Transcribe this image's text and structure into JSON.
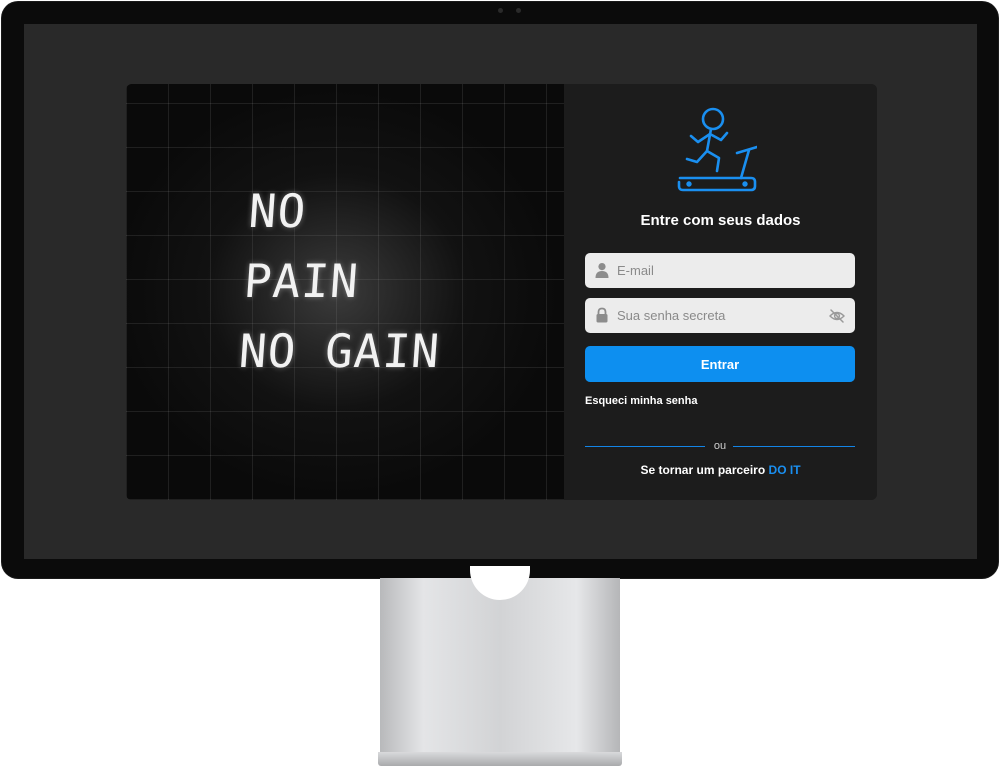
{
  "hero": {
    "lines": [
      "NO",
      "PAIN",
      "NO GAIN"
    ]
  },
  "login": {
    "title": "Entre com seus dados",
    "email_placeholder": "E-mail",
    "password_placeholder": "Sua senha secreta",
    "submit_label": "Entrar",
    "forgot_label": "Esqueci minha senha",
    "divider_label": "ou",
    "partner_text": "Se tornar um parceiro",
    "partner_link": "DO IT"
  },
  "icons": {
    "logo": "treadmill-runner-icon",
    "email": "user-icon",
    "password": "lock-icon",
    "toggle_password": "eye-slash-icon"
  },
  "colors": {
    "accent": "#0d8ff0",
    "link": "#1a8ff0",
    "panel_bg": "#1c1c1c",
    "screen_bg": "#292929",
    "input_bg": "#ececec"
  }
}
